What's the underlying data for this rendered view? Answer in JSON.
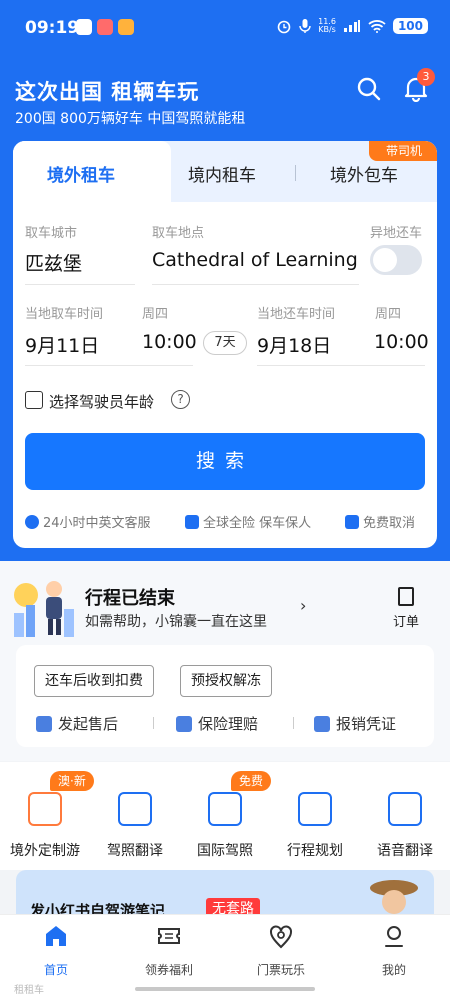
{
  "status": {
    "time": "09:19",
    "net_speed_top": "11.6",
    "net_speed_bottom": "KB/s",
    "battery": "100"
  },
  "header": {
    "title": "这次出国 租辆车玩",
    "subtitle": "200国 800万辆好车 中国驾照就能租",
    "notification_count": "3"
  },
  "tabs": {
    "overseas_rental": "境外租车",
    "domestic_rental": "境内租车",
    "overseas_charter": "境外包车",
    "driver_tag": "带司机"
  },
  "form": {
    "pickup_city_label": "取车城市",
    "pickup_city": "匹兹堡",
    "pickup_location_label": "取车地点",
    "pickup_location": "Cathedral of Learning",
    "return_elsewhere_label": "异地还车",
    "pickup_time_label": "当地取车时间",
    "pickup_weekday": "周四",
    "pickup_date": "9月11日",
    "pickup_time": "10:00",
    "days": "7天",
    "return_time_label": "当地还车时间",
    "return_weekday": "周四",
    "return_date": "9月18日",
    "return_time": "10:00",
    "driver_age_label": "选择驾驶员年龄",
    "help": "?",
    "search_label": "搜索"
  },
  "features": [
    {
      "label": "24小时中英文客服"
    },
    {
      "label": "全球全险 保车保人"
    },
    {
      "label": "免费取消"
    }
  ],
  "trip": {
    "title": "行程已结束",
    "subtitle": "如需帮助，小锦囊一直在这里",
    "chevron": "›",
    "order_label": "订单",
    "chip_deduction": "还车后收到扣费",
    "chip_preauth": "预授权解冻",
    "after_sales": "发起售后",
    "insurance_claim": "保险理赔",
    "reimbursement": "报销凭证"
  },
  "services": [
    {
      "label": "境外定制游",
      "badge": "澳·新"
    },
    {
      "label": "驾照翻译",
      "badge": ""
    },
    {
      "label": "国际驾照",
      "badge": "免费"
    },
    {
      "label": "行程规划",
      "badge": ""
    },
    {
      "label": "语音翻译",
      "badge": ""
    }
  ],
  "promo": {
    "text": "发小红书自驾游笔记",
    "tag": "无套路"
  },
  "tabbar": {
    "home": "首页",
    "coupons": "领券福利",
    "tickets": "门票玩乐",
    "mine": "我的"
  },
  "watermark": "租租车",
  "colors": {
    "brand_blue": "#1e6ff2",
    "button_blue": "#1677ff",
    "accent_orange": "#ff7a1a",
    "badge_red": "#ff5a3c"
  }
}
